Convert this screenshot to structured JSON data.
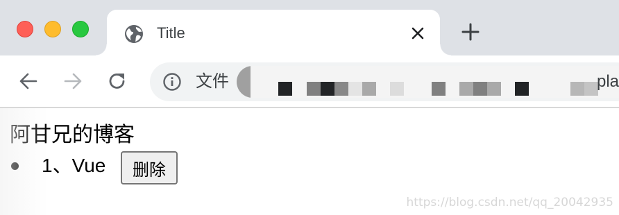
{
  "window": {
    "traffic_lights": [
      "close",
      "minimize",
      "zoom"
    ]
  },
  "tab": {
    "title": "Title",
    "favicon": "globe-icon"
  },
  "toolbar": {
    "security_label": "文件",
    "url_visible_tail": "pla",
    "icons": [
      "back-arrow-icon",
      "forward-arrow-icon",
      "reload-icon",
      "info-icon"
    ]
  },
  "page": {
    "heading": "阿甘兄的博客",
    "items": [
      {
        "text": "1、Vue",
        "button_label": "删除"
      }
    ]
  },
  "watermark": "https://blog.csdn.net/qq_20042935",
  "colors": {
    "tabstrip": "#dee1e6",
    "close": "#fe5f57",
    "minimize": "#febc2e",
    "zoom": "#28c840",
    "omnibox": "#f1f3f4"
  }
}
